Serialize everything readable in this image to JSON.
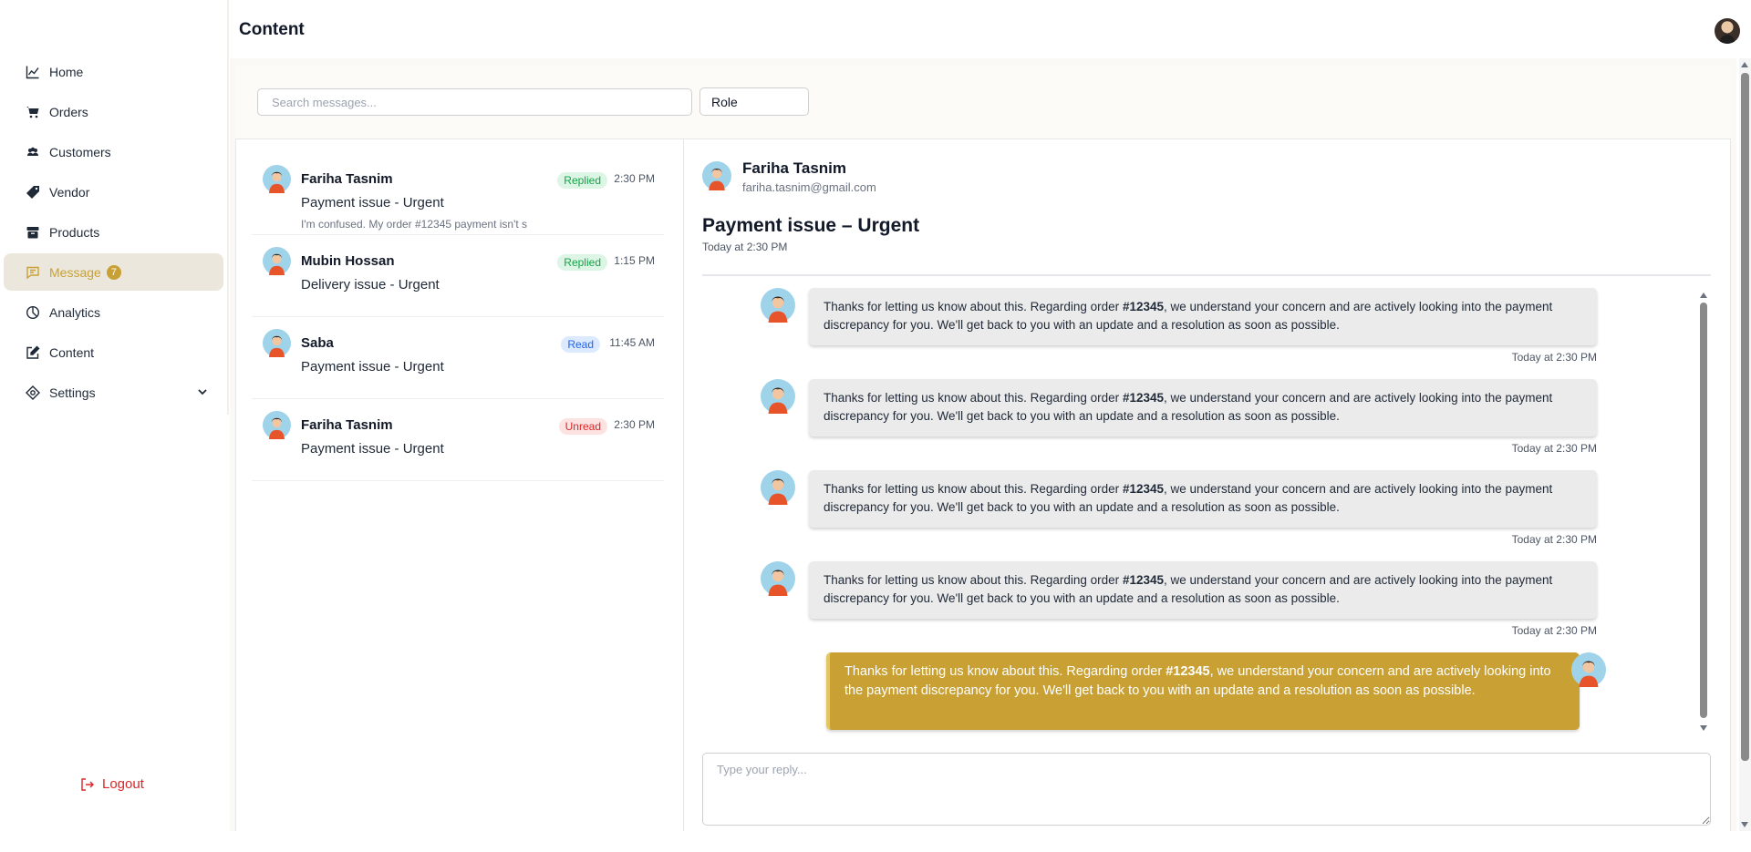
{
  "header": {
    "title": "Content"
  },
  "sidebar": {
    "items": [
      {
        "label": "Home",
        "icon": "chart-line-icon"
      },
      {
        "label": "Orders",
        "icon": "cart-icon"
      },
      {
        "label": "Customers",
        "icon": "users-icon"
      },
      {
        "label": "Vendor",
        "icon": "tag-icon"
      },
      {
        "label": "Products",
        "icon": "box-icon"
      },
      {
        "label": "Message",
        "icon": "message-icon",
        "badge": "7",
        "active": true
      },
      {
        "label": "Analytics",
        "icon": "pie-chart-icon"
      },
      {
        "label": "Content",
        "icon": "edit-icon"
      },
      {
        "label": "Settings",
        "icon": "settings-icon"
      }
    ],
    "logout_label": "Logout"
  },
  "filters": {
    "search_placeholder": "Search messages...",
    "role_label": "Role"
  },
  "messages": [
    {
      "name": "Fariha Tasnim",
      "subject": "Payment issue - Urgent",
      "preview": "I'm confused. My order #12345 payment isn't s",
      "status": "Replied",
      "time": "2:30 PM"
    },
    {
      "name": "Mubin Hossan",
      "subject": "Delivery issue - Urgent",
      "preview": "",
      "status": "Replied",
      "time": "1:15 PM"
    },
    {
      "name": "Saba",
      "subject": "Payment issue - Urgent",
      "preview": "",
      "status": "Read",
      "time": "11:45 AM"
    },
    {
      "name": "Fariha Tasnim",
      "subject": "Payment issue - Urgent",
      "preview": "",
      "status": "Unread",
      "time": "2:30 PM"
    }
  ],
  "conversation": {
    "name": "Fariha Tasnim",
    "email": "fariha.tasnim@gmail.com",
    "subject": "Payment issue – Urgent",
    "date": "Today at 2:30 PM",
    "thread": [
      {
        "text_before": "Thanks for letting us know about this. Regarding order ",
        "order": "#12345",
        "text_after": ", we understand your concern and are actively looking into the payment discrepancy for you. We'll get back to you with an update and a resolution as soon as possible.",
        "time": "Today at 2:30 PM"
      },
      {
        "text_before": "Thanks for letting us know about this. Regarding order ",
        "order": "#12345",
        "text_after": ", we understand your concern and are actively looking into the payment discrepancy for you. We'll get back to you with an update and a resolution as soon as possible.",
        "time": "Today at 2:30 PM"
      },
      {
        "text_before": "Thanks for letting us know about this. Regarding order ",
        "order": "#12345",
        "text_after": ", we understand your concern and are actively looking into the payment discrepancy for you. We'll get back to you with an update and a resolution as soon as possible.",
        "time": "Today at 2:30 PM"
      },
      {
        "text_before": "Thanks for letting us know about this. Regarding order ",
        "order": "#12345",
        "text_after": ", we understand your concern and are actively looking into the payment discrepancy for you. We'll get back to you with an update and a resolution as soon as possible.",
        "time": "Today at 2:30 PM"
      }
    ],
    "outgoing": {
      "text_before": "Thanks for letting us know about this. Regarding order ",
      "order": "#12345",
      "text_after": ", we understand your concern and are actively looking into the payment discrepancy for you. We'll get back to you with an update and a resolution as soon as possible."
    },
    "reply_placeholder": "Type your reply..."
  },
  "colors": {
    "accent": "#c9a034",
    "active_bg": "#ebe7dd",
    "logout": "#dc2626"
  }
}
